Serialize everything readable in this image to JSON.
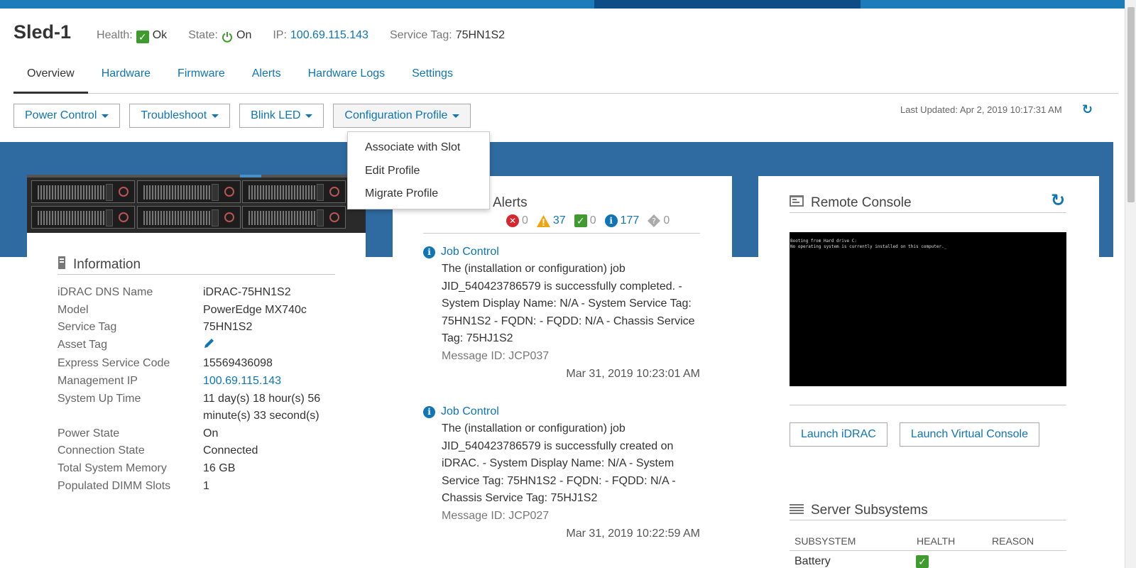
{
  "header": {
    "title": "Sled-1",
    "health_label": "Health:",
    "health_value": "Ok",
    "state_label": "State:",
    "state_value": "On",
    "ip_label": "IP:",
    "ip_value": "100.69.115.143",
    "service_tag_label": "Service Tag:",
    "service_tag_value": "75HN1S2"
  },
  "tabs": [
    {
      "label": "Overview"
    },
    {
      "label": "Hardware"
    },
    {
      "label": "Firmware"
    },
    {
      "label": "Alerts"
    },
    {
      "label": "Hardware Logs"
    },
    {
      "label": "Settings"
    }
  ],
  "toolbar": {
    "power_control": "Power Control",
    "troubleshoot": "Troubleshoot",
    "blink_led": "Blink LED",
    "configuration_profile": "Configuration Profile",
    "last_updated": "Last Updated: Apr 2, 2019 10:17:31 AM"
  },
  "config_menu": {
    "items": [
      {
        "label": "Associate with Slot"
      },
      {
        "label": "Edit Profile"
      },
      {
        "label": "Migrate Profile"
      }
    ]
  },
  "information": {
    "title": "Information",
    "rows": [
      {
        "key": "iDRAC DNS Name",
        "value": "iDRAC-75HN1S2"
      },
      {
        "key": "Model",
        "value": "PowerEdge MX740c"
      },
      {
        "key": "Service Tag",
        "value": "75HN1S2"
      },
      {
        "key": "Asset Tag",
        "value": ""
      },
      {
        "key": "Express Service Code",
        "value": "15569436098"
      },
      {
        "key": "Management IP",
        "value": "100.69.115.143"
      },
      {
        "key": "System Up Time",
        "value": "11 day(s) 18 hour(s) 56 minute(s) 33 second(s)"
      },
      {
        "key": "Power State",
        "value": "On"
      },
      {
        "key": "Connection State",
        "value": "Connected"
      },
      {
        "key": "Total System Memory",
        "value": "16 GB"
      },
      {
        "key": "Populated DIMM Slots",
        "value": "1"
      }
    ]
  },
  "alerts": {
    "title": "Alerts",
    "counts": {
      "critical": "0",
      "warning": "37",
      "ok": "0",
      "info": "177",
      "unknown": "0"
    },
    "items": [
      {
        "title": "Job Control",
        "body": "The (installation or configuration) job JID_540423786579 is successfully completed. - System Display Name: N/A - System Service Tag: 75HN1S2 - FQDN: - FQDD: N/A - Chassis Service Tag: 75HJ1S2",
        "message_id": "Message ID: JCP037",
        "timestamp": "Mar 31, 2019 10:23:01 AM"
      },
      {
        "title": "Job Control",
        "body": "The (installation or configuration) job JID_540423786579 is successfully created on iDRAC. - System Display Name: N/A - System Service Tag: 75HN1S2 - FQDN: - FQDD: N/A - Chassis Service Tag: 75HJ1S2",
        "message_id": "Message ID: JCP027",
        "timestamp": "Mar 31, 2019 10:22:59 AM"
      }
    ]
  },
  "remote_console": {
    "title": "Remote Console",
    "screen_lines": [
      "Booting from Hard drive C:",
      "No operating system is currently installed on this computer._"
    ],
    "launch_idrac": "Launch iDRAC",
    "launch_virtual_console": "Launch Virtual Console"
  },
  "server_subsystems": {
    "title": "Server Subsystems",
    "columns": [
      "SUBSYSTEM",
      "HEALTH",
      "REASON"
    ],
    "rows": [
      {
        "subsystem": "Battery"
      }
    ]
  },
  "colors": {
    "accent": "#0f75b5",
    "band": "#2f6aa0",
    "ok": "#3f9b2e",
    "warning": "#f0a30a",
    "critical": "#d9262e"
  }
}
